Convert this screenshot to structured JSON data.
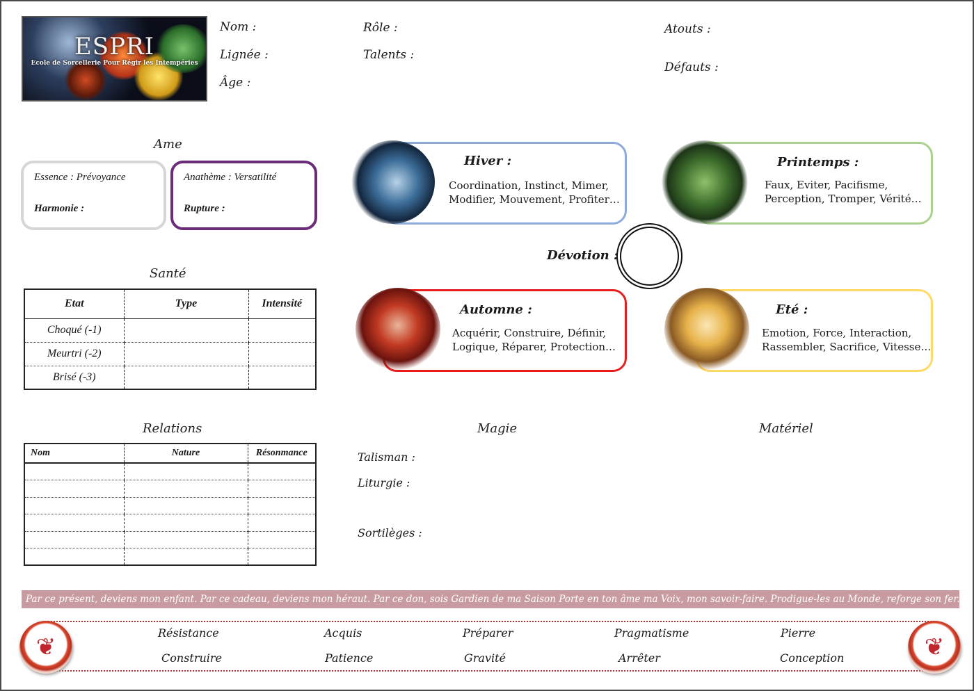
{
  "logo": {
    "title": "ESPRI",
    "subtitle": "Ecole de Sorcellerie Pour Régir les Intempéries"
  },
  "identity": {
    "nom": "Nom :",
    "lignee": "Lignée :",
    "age": "Âge :",
    "role": "Rôle :",
    "talents": "Talents :",
    "atouts": "Atouts :",
    "defauts": "Défauts :"
  },
  "ame": {
    "title": "Ame",
    "essence": "Essence : Prévoyance",
    "harmonie": "Harmonie :",
    "anatheme": "Anathème : Versatilité",
    "rupture": "Rupture :"
  },
  "sante": {
    "title": "Santé",
    "headers": [
      "Etat",
      "Type",
      "Intensité"
    ],
    "rows": [
      "Choqué (-1)",
      "Meurtri (-2)",
      "Brisé (-3)"
    ]
  },
  "relations": {
    "title": "Relations",
    "headers": [
      "Nom",
      "Nature",
      "Résonmance"
    ]
  },
  "seasons": {
    "hiver": {
      "title": "Hiver :",
      "line1": "Coordination, Instinct, Mimer,",
      "line2": "Modifier, Mouvement, Profiter…",
      "color": "#8eaadb"
    },
    "printemps": {
      "title": "Printemps :",
      "line1": "Faux, Eviter, Pacifisme,",
      "line2": "Perception, Tromper, Vérité…",
      "color": "#a9d18e"
    },
    "automne": {
      "title": "Automne :",
      "line1": "Acquérir, Construire, Définir,",
      "line2": "Logique, Réparer, Protection…",
      "color": "#e81e1e"
    },
    "ete": {
      "title": "Eté :",
      "line1": "Emotion, Force, Interaction,",
      "line2": "Rassembler, Sacrifice, Vitesse…",
      "color": "#ffd966"
    }
  },
  "devotion": "Dévotion :",
  "magie": {
    "title": "Magie",
    "talisman": "Talisman :",
    "liturgie": "Liturgie :",
    "sortileges": "Sortilèges :"
  },
  "materiel": {
    "title": "Matériel"
  },
  "quote": "Par ce présent, deviens mon enfant. Par ce cadeau, deviens mon héraut. Par ce don, sois Gardien de ma Saison Porte en ton âme ma Voix, mon savoir-faire. Prodigue-les au Monde, reforge son fer.",
  "footer_words": {
    "row1": [
      "Résistance",
      "Acquis",
      "Préparer",
      "Pragmatisme",
      "Pierre"
    ],
    "row2": [
      "Construire",
      "Patience",
      "Gravité",
      "Arrêter",
      "Conception"
    ]
  }
}
